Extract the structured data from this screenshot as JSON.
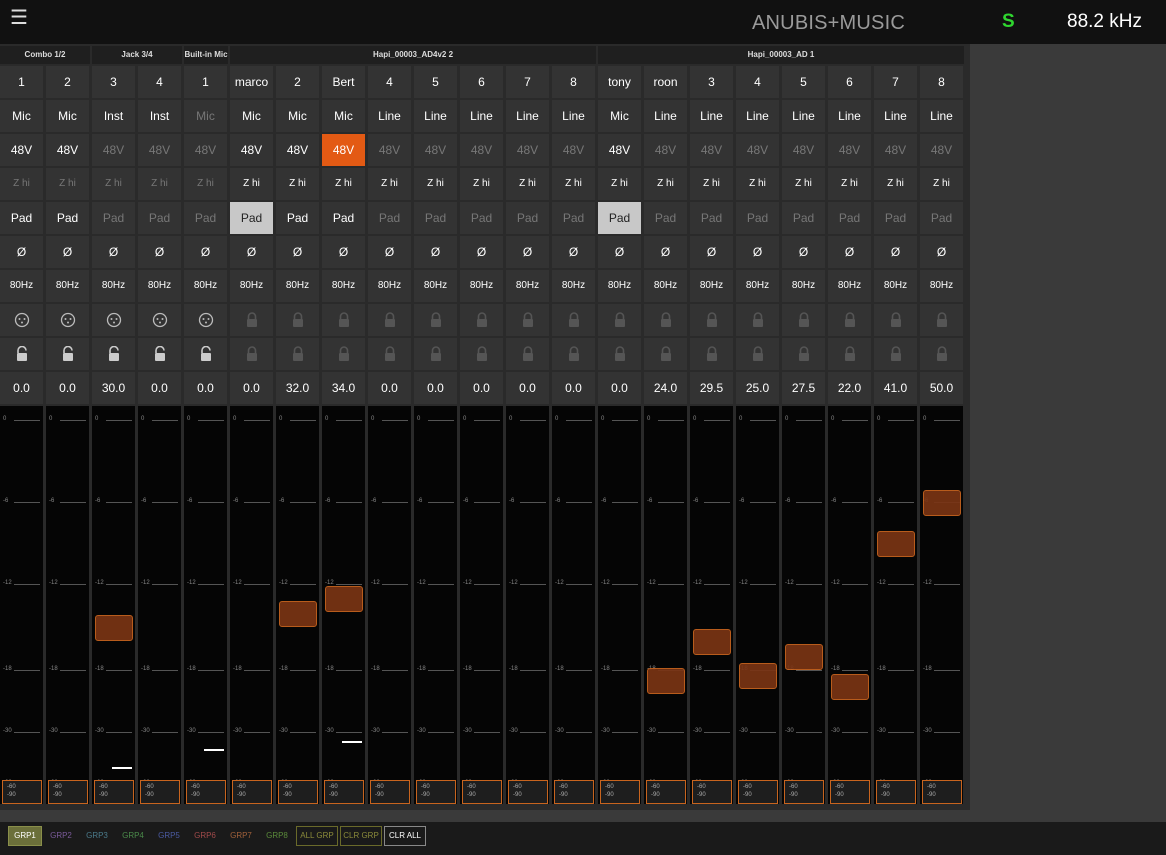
{
  "topbar": {
    "menu_icon": "hamburger-icon",
    "title": "ANUBIS+MUSIC",
    "sync_status": "S",
    "sample_rate": "88.2 kHz"
  },
  "groups": [
    {
      "label": "Combo 1/2",
      "start": 0,
      "count": 2
    },
    {
      "label": "Jack 3/4",
      "start": 2,
      "count": 2
    },
    {
      "label": "Built-in Mic",
      "start": 4,
      "count": 1
    },
    {
      "label": "Hapi_00003_AD4v2 2",
      "start": 5,
      "count": 8
    },
    {
      "label": "Hapi_00003_AD 1",
      "start": 13,
      "count": 8
    }
  ],
  "channels": [
    {
      "name": "1",
      "type": "Mic",
      "p48": true,
      "p48_on": false,
      "zhi": false,
      "pad": true,
      "pad_on": false,
      "phase": "Ø",
      "hpf": "80Hz",
      "icon1": "xlr-icon",
      "icon2": "unlock-icon",
      "gain": "0.0",
      "fader": -60,
      "meter": 2,
      "peak": null
    },
    {
      "name": "2",
      "type": "Mic",
      "p48": true,
      "p48_on": false,
      "zhi": false,
      "pad": true,
      "pad_on": false,
      "phase": "Ø",
      "hpf": "80Hz",
      "icon1": "xlr-icon",
      "icon2": "unlock-icon",
      "gain": "0.0",
      "fader": -60,
      "meter": 2,
      "peak": null
    },
    {
      "name": "3",
      "type": "Inst",
      "p48": false,
      "p48_on": false,
      "zhi": false,
      "pad": false,
      "pad_on": false,
      "phase": "Ø",
      "hpf": "80Hz",
      "icon1": "xlr-icon",
      "icon2": "unlock-icon",
      "gain": "30.0",
      "fader": -15,
      "meter": 5,
      "peak": -50
    },
    {
      "name": "4",
      "type": "Inst",
      "p48": false,
      "p48_on": false,
      "zhi": false,
      "pad": false,
      "pad_on": false,
      "phase": "Ø",
      "hpf": "80Hz",
      "icon1": "xlr-icon",
      "icon2": "unlock-icon",
      "gain": "0.0",
      "fader": -60,
      "meter": 5,
      "peak": null
    },
    {
      "name": "1",
      "type": "Mic",
      "type_dim": true,
      "p48": false,
      "p48_on": false,
      "zhi": false,
      "pad": false,
      "pad_on": false,
      "phase": "Ø",
      "hpf": "80Hz",
      "icon1": "xlr-icon",
      "icon2": "unlock-icon",
      "gain": "0.0",
      "fader": -60,
      "meter": 4,
      "peak": -40
    },
    {
      "name": "marco",
      "type": "Mic",
      "p48": true,
      "p48_on": false,
      "zhi": true,
      "pad": true,
      "pad_on": true,
      "phase": "Ø",
      "hpf": "80Hz",
      "icon1": "lock-icon",
      "icon2": "lock-icon",
      "gain": "0.0",
      "fader": -60,
      "meter": 0,
      "peak": null
    },
    {
      "name": "2",
      "type": "Mic",
      "p48": true,
      "p48_on": false,
      "zhi": true,
      "pad": true,
      "pad_on": false,
      "phase": "Ø",
      "hpf": "80Hz",
      "icon1": "lock-icon",
      "icon2": "lock-icon",
      "gain": "32.0",
      "fader": -14,
      "meter": 4,
      "peak": null
    },
    {
      "name": "Bert",
      "type": "Mic",
      "p48": true,
      "p48_on": true,
      "zhi": true,
      "pad": true,
      "pad_on": false,
      "phase": "Ø",
      "hpf": "80Hz",
      "icon1": "lock-icon",
      "icon2": "lock-icon",
      "gain": "34.0",
      "fader": -13,
      "meter": 12,
      "peak": -35
    },
    {
      "name": "4",
      "type": "Line",
      "p48": false,
      "p48_on": false,
      "zhi": true,
      "pad": false,
      "pad_on": false,
      "phase": "Ø",
      "hpf": "80Hz",
      "icon1": "lock-icon",
      "icon2": "lock-icon",
      "gain": "0.0",
      "fader": -60,
      "meter": 0,
      "peak": null
    },
    {
      "name": "5",
      "type": "Line",
      "p48": false,
      "p48_on": false,
      "zhi": true,
      "pad": false,
      "pad_on": false,
      "phase": "Ø",
      "hpf": "80Hz",
      "icon1": "lock-icon",
      "icon2": "lock-icon",
      "gain": "0.0",
      "fader": -60,
      "meter": 0,
      "peak": null
    },
    {
      "name": "6",
      "type": "Line",
      "p48": false,
      "p48_on": false,
      "zhi": true,
      "pad": false,
      "pad_on": false,
      "phase": "Ø",
      "hpf": "80Hz",
      "icon1": "lock-icon",
      "icon2": "lock-icon",
      "gain": "0.0",
      "fader": -60,
      "meter": 0,
      "peak": null
    },
    {
      "name": "7",
      "type": "Line",
      "p48": false,
      "p48_on": false,
      "zhi": true,
      "pad": false,
      "pad_on": false,
      "phase": "Ø",
      "hpf": "80Hz",
      "icon1": "lock-icon",
      "icon2": "lock-icon",
      "gain": "0.0",
      "fader": -60,
      "meter": 0,
      "peak": null
    },
    {
      "name": "8",
      "type": "Line",
      "p48": false,
      "p48_on": false,
      "zhi": true,
      "pad": false,
      "pad_on": false,
      "phase": "Ø",
      "hpf": "80Hz",
      "icon1": "lock-icon",
      "icon2": "lock-icon",
      "gain": "0.0",
      "fader": -60,
      "meter": 0,
      "peak": null
    },
    {
      "name": "tony",
      "type": "Mic",
      "p48": true,
      "p48_on": false,
      "zhi": true,
      "pad": true,
      "pad_on": true,
      "phase": "Ø",
      "hpf": "80Hz",
      "icon1": "lock-icon",
      "icon2": "lock-icon",
      "gain": "0.0",
      "fader": -60,
      "meter": 0,
      "peak": null
    },
    {
      "name": "roon",
      "type": "Line",
      "p48": false,
      "p48_on": false,
      "zhi": true,
      "pad": false,
      "pad_on": false,
      "phase": "Ø",
      "hpf": "80Hz",
      "icon1": "lock-icon",
      "icon2": "lock-icon",
      "gain": "24.0",
      "fader": -20,
      "meter": 2,
      "peak": null
    },
    {
      "name": "3",
      "type": "Line",
      "p48": false,
      "p48_on": false,
      "zhi": true,
      "pad": false,
      "pad_on": false,
      "phase": "Ø",
      "hpf": "80Hz",
      "icon1": "lock-icon",
      "icon2": "lock-icon",
      "gain": "29.5",
      "fader": -16,
      "meter": 4,
      "peak": null
    },
    {
      "name": "4",
      "type": "Line",
      "p48": false,
      "p48_on": false,
      "zhi": true,
      "pad": false,
      "pad_on": false,
      "phase": "Ø",
      "hpf": "80Hz",
      "icon1": "lock-icon",
      "icon2": "lock-icon",
      "gain": "25.0",
      "fader": -19,
      "meter": 2,
      "peak": null
    },
    {
      "name": "5",
      "type": "Line",
      "p48": false,
      "p48_on": false,
      "zhi": true,
      "pad": false,
      "pad_on": false,
      "phase": "Ø",
      "hpf": "80Hz",
      "icon1": "lock-icon",
      "icon2": "lock-icon",
      "gain": "27.5",
      "fader": -17,
      "meter": 2,
      "peak": null
    },
    {
      "name": "6",
      "type": "Line",
      "p48": false,
      "p48_on": false,
      "zhi": true,
      "pad": false,
      "pad_on": false,
      "phase": "Ø",
      "hpf": "80Hz",
      "icon1": "lock-icon",
      "icon2": "lock-icon",
      "gain": "22.0",
      "fader": -21,
      "meter": 2,
      "peak": null
    },
    {
      "name": "7",
      "type": "Line",
      "p48": false,
      "p48_on": false,
      "zhi": true,
      "pad": false,
      "pad_on": false,
      "phase": "Ø",
      "hpf": "80Hz",
      "icon1": "lock-icon",
      "icon2": "lock-icon",
      "gain": "41.0",
      "fader": -9,
      "meter": 4,
      "peak": null
    },
    {
      "name": "8",
      "type": "Line",
      "p48": false,
      "p48_on": false,
      "zhi": true,
      "pad": false,
      "pad_on": false,
      "phase": "Ø",
      "hpf": "80Hz",
      "icon1": "lock-icon",
      "icon2": "lock-icon",
      "gain": "50.0",
      "fader": -6,
      "meter": 4,
      "peak": null
    }
  ],
  "labels": {
    "p48": "48V",
    "zhi": "Z hi",
    "pad": "Pad"
  },
  "fader_ticks": [
    "0",
    "-6",
    "-12",
    "-18",
    "-30",
    "-60"
  ],
  "fader_base": {
    "top": "-60",
    "bottom": "-90"
  },
  "group_buttons": [
    {
      "label": "GRP1",
      "color": "#ffffff",
      "bg": "#6b6f3a",
      "border": "#8a8f4a"
    },
    {
      "label": "GRP2",
      "color": "#7a5a9a",
      "bg": "#1a1a1a",
      "border": "#1a1a1a"
    },
    {
      "label": "GRP3",
      "color": "#4a7a8a",
      "bg": "#1a1a1a",
      "border": "#1a1a1a"
    },
    {
      "label": "GRP4",
      "color": "#4a8a4a",
      "bg": "#1a1a1a",
      "border": "#1a1a1a"
    },
    {
      "label": "GRP5",
      "color": "#4a5aa0",
      "bg": "#1a1a1a",
      "border": "#1a1a1a"
    },
    {
      "label": "GRP6",
      "color": "#a04a4a",
      "bg": "#1a1a1a",
      "border": "#1a1a1a"
    },
    {
      "label": "GRP7",
      "color": "#a0603a",
      "bg": "#1a1a1a",
      "border": "#1a1a1a"
    },
    {
      "label": "GRP8",
      "color": "#5a8a3a",
      "bg": "#1a1a1a",
      "border": "#1a1a1a"
    },
    {
      "label": "ALL GRP",
      "color": "#8a8a3a",
      "bg": "#1a1a1a",
      "border": "#6a6a2a"
    },
    {
      "label": "CLR GRP",
      "color": "#8a8a3a",
      "bg": "#1a1a1a",
      "border": "#6a6a2a"
    },
    {
      "label": "CLR ALL",
      "color": "#ffffff",
      "bg": "#1a1a1a",
      "border": "#888888"
    }
  ],
  "colors": {
    "accent_orange": "#e35a14",
    "fader_knob": "#7a3414",
    "sync_green": "#2fd62f"
  }
}
